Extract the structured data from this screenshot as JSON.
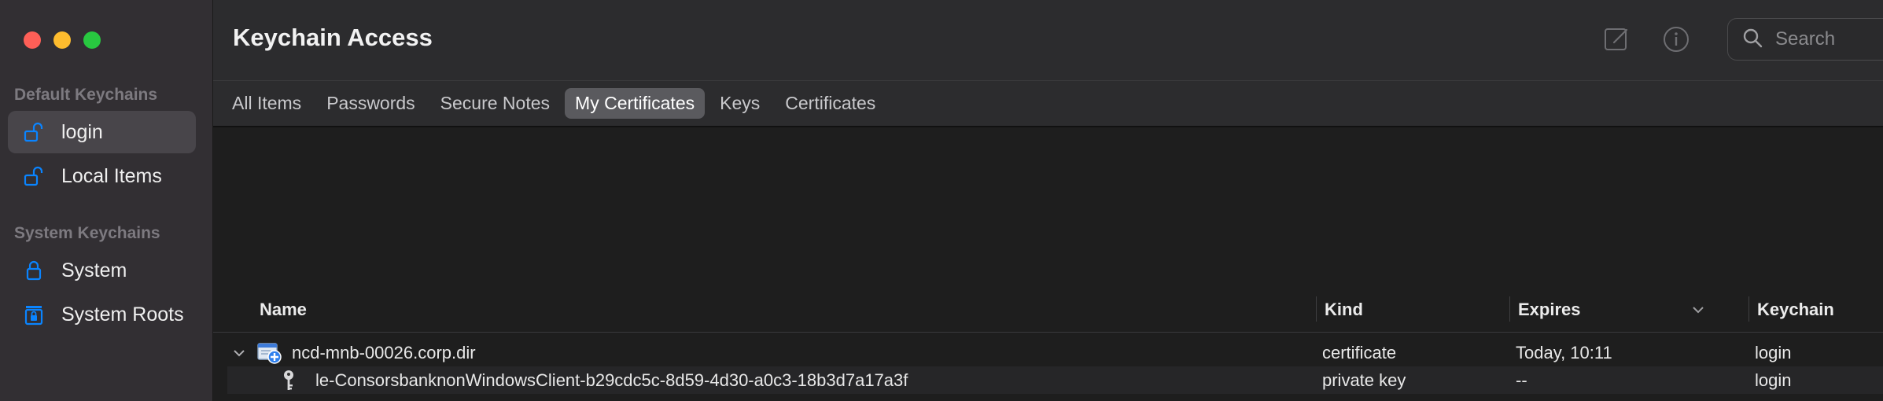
{
  "window": {
    "title": "Keychain Access"
  },
  "sidebar": {
    "default_title": "Default Keychains",
    "system_title": "System Keychains",
    "items": [
      {
        "label": "login",
        "icon": "unlock-icon"
      },
      {
        "label": "Local Items",
        "icon": "unlock-icon"
      },
      {
        "label": "System",
        "icon": "lock-icon"
      },
      {
        "label": "System Roots",
        "icon": "cabinet-lock-icon"
      }
    ]
  },
  "toolbar": {
    "title": "Keychain Access",
    "search_placeholder": "Search"
  },
  "tabs": [
    "All Items",
    "Passwords",
    "Secure Notes",
    "My Certificates",
    "Keys",
    "Certificates"
  ],
  "active_tab": "My Certificates",
  "table": {
    "columns": [
      "Name",
      "Kind",
      "Expires",
      "Keychain"
    ],
    "rows": [
      {
        "name": "ncd-mnb-00026.corp.dir",
        "kind": "certificate",
        "expires": "Today, 10:11",
        "keychain": "login"
      },
      {
        "name": "le-ConsorsbanknonWindowsClient-b29cdc5c-8d59-4d30-a0c3-18b3d7a17a3f",
        "kind": "private key",
        "expires": "--",
        "keychain": "login"
      }
    ]
  },
  "colors": {
    "accent": "#0a84ff",
    "sidebar_bg": "#322f33",
    "active_tab_bg": "#5a5a5e"
  }
}
